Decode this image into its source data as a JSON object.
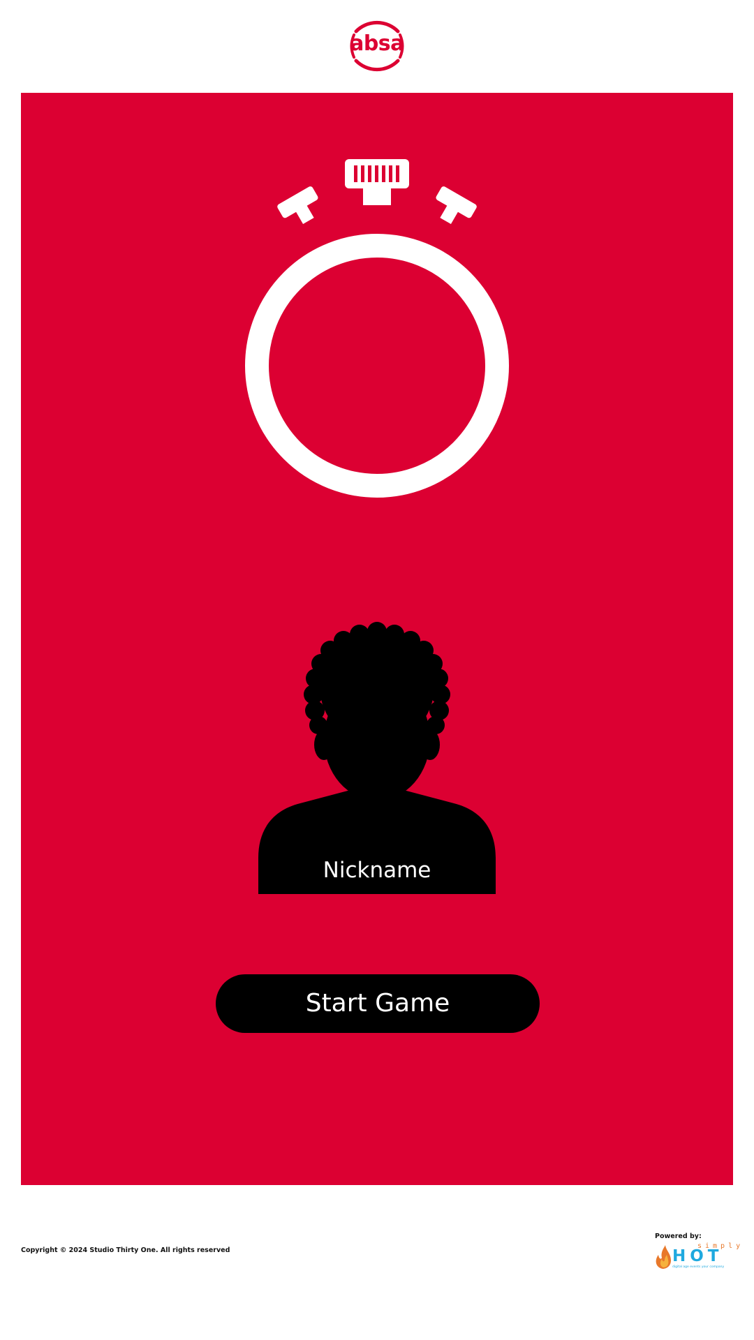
{
  "brand": {
    "logo_text": "absa",
    "accent_color": "#dc0032"
  },
  "game": {
    "timer_icon": "stopwatch-icon",
    "avatar_icon": "person-silhouette-icon",
    "nickname": "Nickname",
    "start_label": "Start Game"
  },
  "footer": {
    "copyright": "Copyright © 2024 Studio Thirty One. All rights reserved",
    "powered_by": "Powered by:",
    "sponsor_simply": "simply",
    "sponsor_hot": "HOT",
    "sponsor_tagline": "digital age events your company",
    "sponsor_colors": {
      "simply": "#e8782a",
      "hot": "#1fa9df"
    }
  }
}
